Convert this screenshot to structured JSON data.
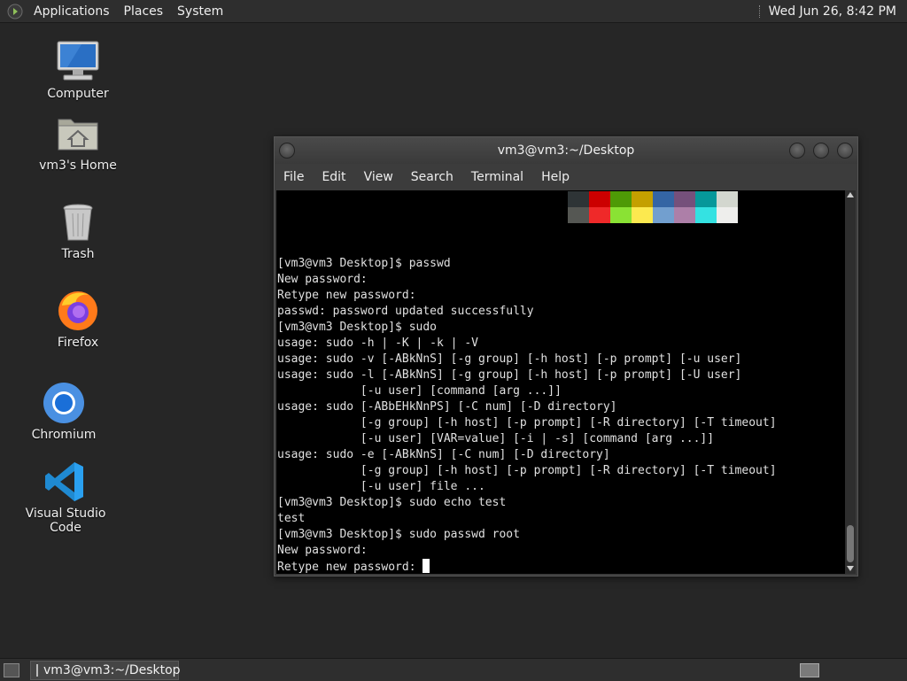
{
  "top_panel": {
    "menus": [
      "Applications",
      "Places",
      "System"
    ],
    "clock": "Wed Jun 26,  8:42 PM"
  },
  "desktop": {
    "icons": [
      {
        "label": "Computer",
        "icon": "computer-icon"
      },
      {
        "label": "vm3's Home",
        "icon": "home-folder-icon"
      },
      {
        "label": "Trash",
        "icon": "trash-icon"
      },
      {
        "label": "Firefox",
        "icon": "firefox-icon"
      },
      {
        "label": "Chromium",
        "icon": "chromium-icon"
      },
      {
        "label": "Visual Studio Code",
        "icon": "vscode-icon"
      }
    ]
  },
  "terminal": {
    "title": "vm3@vm3:~/Desktop",
    "menu": [
      "File",
      "Edit",
      "View",
      "Search",
      "Terminal",
      "Help"
    ],
    "palette_row1": [
      "#2e3436",
      "#cc0000",
      "#4e9a06",
      "#c4a000",
      "#3465a4",
      "#75507b",
      "#06989a",
      "#d3d7cf"
    ],
    "palette_row2": [
      "#555753",
      "#ef2929",
      "#8ae234",
      "#fce94f",
      "#729fcf",
      "#ad7fa8",
      "#34e2e2",
      "#eeeeec"
    ],
    "lines": [
      "[vm3@vm3 Desktop]$ passwd",
      "New password:",
      "Retype new password:",
      "passwd: password updated successfully",
      "[vm3@vm3 Desktop]$ sudo",
      "usage: sudo -h | -K | -k | -V",
      "usage: sudo -v [-ABkNnS] [-g group] [-h host] [-p prompt] [-u user]",
      "usage: sudo -l [-ABkNnS] [-g group] [-h host] [-p prompt] [-U user]",
      "            [-u user] [command [arg ...]]",
      "usage: sudo [-ABbEHkNnPS] [-C num] [-D directory]",
      "            [-g group] [-h host] [-p prompt] [-R directory] [-T timeout]",
      "            [-u user] [VAR=value] [-i | -s] [command [arg ...]]",
      "usage: sudo -e [-ABkNnS] [-C num] [-D directory]",
      "            [-g group] [-h host] [-p prompt] [-R directory] [-T timeout]",
      "            [-u user] file ...",
      "[vm3@vm3 Desktop]$ sudo echo test",
      "test",
      "[vm3@vm3 Desktop]$ sudo passwd root",
      "New password:",
      "Retype new password: "
    ]
  },
  "taskbar": {
    "window_label": "vm3@vm3:~/Desktop"
  }
}
